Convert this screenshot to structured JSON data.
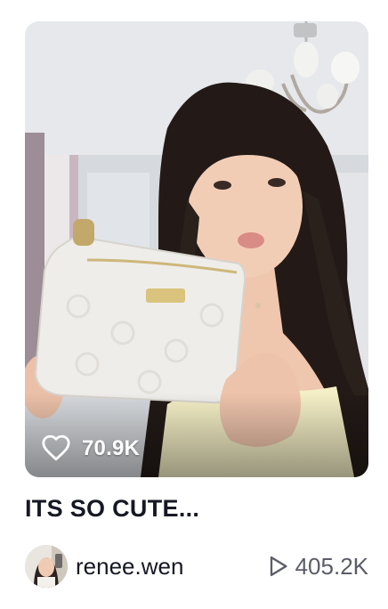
{
  "video_card": {
    "thumbnail_alt": "",
    "likes": "70.9K",
    "title": "ITS SO CUTE...",
    "author": {
      "username": "renee.wen"
    },
    "views": "405.2K"
  },
  "icons": {
    "like": "heart-outline-icon",
    "views": "play-outline-icon"
  },
  "colors": {
    "text_primary": "#161823",
    "text_secondary": "#5b5d66",
    "overlay_text": "#ffffff"
  }
}
